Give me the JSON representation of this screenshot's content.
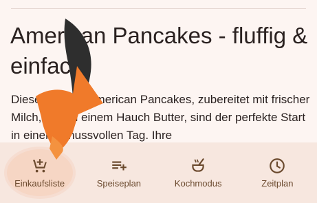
{
  "article": {
    "title": "American Pancakes - fluffig & einfach",
    "description": "Diese fluffigen American Pancakes, zubereitet mit frischer Milch, Ei und einem Hauch Butter, sind der perfekte Start in einen genussvollen Tag. Ihre"
  },
  "bottom_nav": {
    "items": [
      {
        "label": "Einkaufsliste",
        "icon": "cart-plus-icon",
        "highlighted": true
      },
      {
        "label": "Speiseplan",
        "icon": "playlist-add-icon",
        "highlighted": false
      },
      {
        "label": "Kochmodus",
        "icon": "cooking-pot-icon",
        "highlighted": false
      },
      {
        "label": "Zeitplan",
        "icon": "clock-icon",
        "highlighted": false
      }
    ]
  },
  "colors": {
    "background": "#fdf5f2",
    "nav_background": "#f7e7df",
    "accent": "#8b5a2b",
    "highlight": "#f6d6c4",
    "pointer_orange": "#f07a2a",
    "pointer_dark": "#2e2e2e"
  }
}
